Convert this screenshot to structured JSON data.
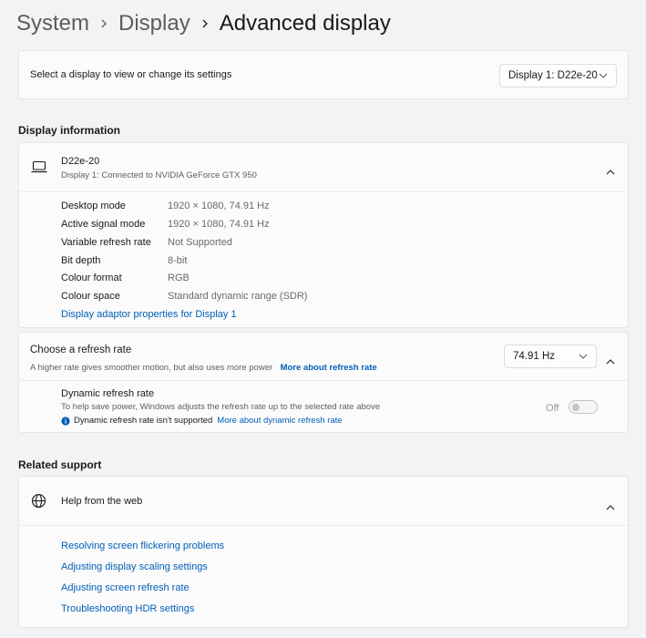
{
  "breadcrumb": {
    "level1": "System",
    "level2": "Display",
    "current": "Advanced display"
  },
  "select_display": {
    "label": "Select a display to view or change its settings",
    "value": "Display 1: D22e-20"
  },
  "display_information": {
    "title": "Display information",
    "monitor_name": "D22e-20",
    "monitor_subtitle": "Display 1: Connected to NVIDIA GeForce GTX 950",
    "rows": [
      {
        "label": "Desktop mode",
        "value": "1920 × 1080, 74.91 Hz"
      },
      {
        "label": "Active signal mode",
        "value": "1920 × 1080, 74.91 Hz"
      },
      {
        "label": "Variable refresh rate",
        "value": "Not Supported"
      },
      {
        "label": "Bit depth",
        "value": "8-bit"
      },
      {
        "label": "Colour format",
        "value": "RGB"
      },
      {
        "label": "Colour space",
        "value": "Standard dynamic range (SDR)"
      }
    ],
    "adapter_link": "Display adaptor properties for Display 1"
  },
  "refresh_rate": {
    "title": "Choose a refresh rate",
    "description": "A higher rate gives smoother motion, but also uses more power",
    "more_link": "More about refresh rate",
    "value": "74.91 Hz"
  },
  "dynamic_refresh": {
    "title": "Dynamic refresh rate",
    "description": "To help save power, Windows adjusts the refresh rate up to the selected rate above",
    "info_text": "Dynamic refresh rate isn't supported",
    "more_link": "More about dynamic refresh rate",
    "toggle_state": "Off"
  },
  "related_support": {
    "title": "Related support",
    "help_title": "Help from the web",
    "links": [
      "Resolving screen flickering problems",
      "Adjusting display scaling settings",
      "Adjusting screen refresh rate",
      "Troubleshooting HDR settings"
    ]
  },
  "colors": {
    "accent": "#005fb8",
    "background": "#f3f3f3",
    "card": "#fbfbfb"
  }
}
